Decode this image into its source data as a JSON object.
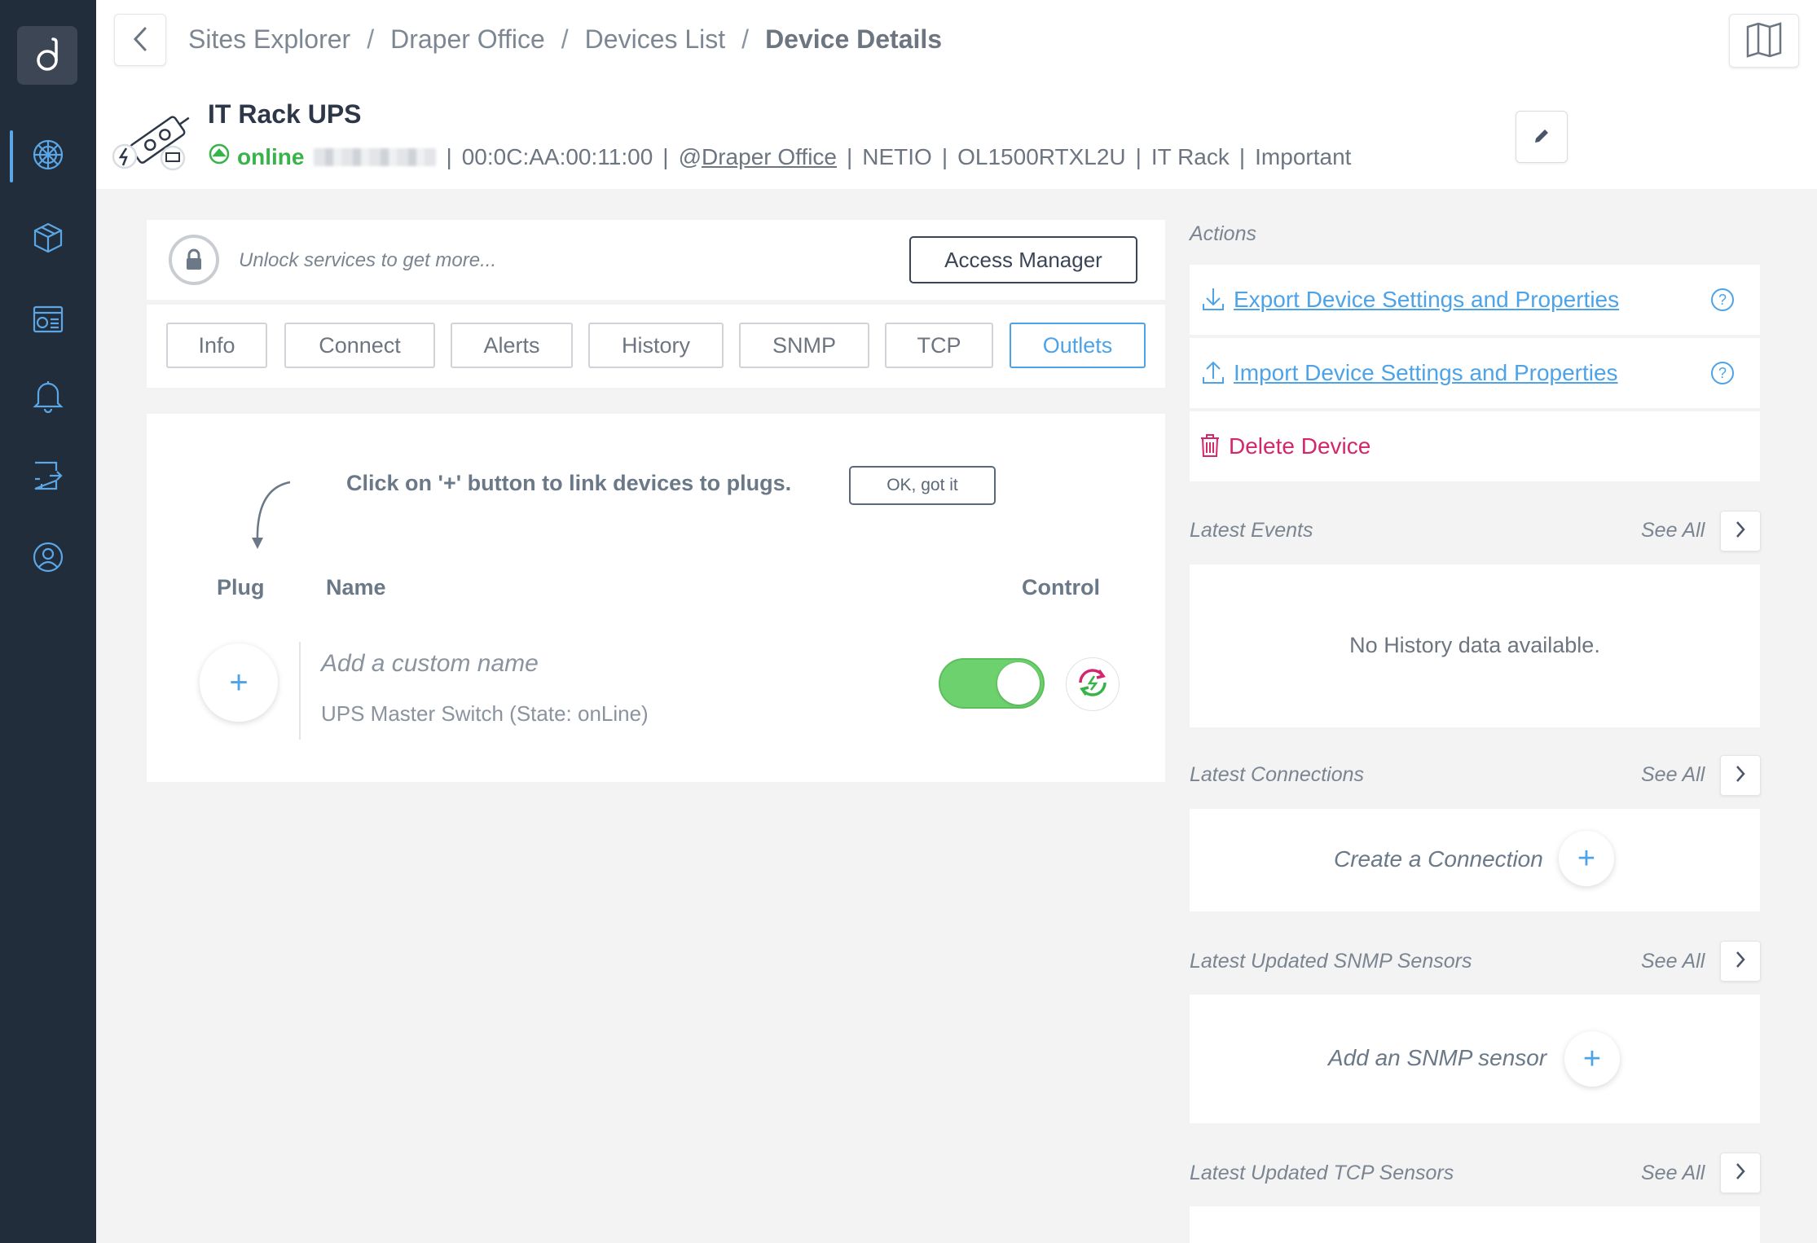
{
  "breadcrumb": {
    "items": [
      "Sites Explorer",
      "Draper Office",
      "Devices List"
    ],
    "current": "Device Details",
    "separator": "/"
  },
  "device": {
    "name": "IT Rack UPS",
    "status": "online",
    "mac": "00:0C:AA:00:11:00",
    "site_prefix": "@",
    "site": "Draper Office",
    "vendor": "NETIO",
    "model": "OL1500RTXL2U",
    "location": "IT Rack",
    "tag": "Important"
  },
  "unlock": {
    "text": "Unlock services to get more...",
    "button": "Access Manager"
  },
  "tabs": [
    {
      "label": "Info",
      "active": false
    },
    {
      "label": "Connect",
      "active": false
    },
    {
      "label": "Alerts",
      "active": false
    },
    {
      "label": "History",
      "active": false
    },
    {
      "label": "SNMP",
      "active": false
    },
    {
      "label": "TCP",
      "active": false
    },
    {
      "label": "Outlets",
      "active": true
    }
  ],
  "outlets": {
    "hint": "Click on '+' button to link devices to plugs.",
    "ok_button": "OK, got it",
    "columns": {
      "plug": "Plug",
      "name": "Name",
      "control": "Control"
    },
    "row": {
      "plus": "+",
      "placeholder_name": "Add a custom name",
      "description": "UPS Master Switch (State: onLine)",
      "toggle_on": true
    }
  },
  "actions": {
    "title": "Actions",
    "export": "Export Device Settings and Properties",
    "import": "Import Device Settings and Properties",
    "delete": "Delete Device",
    "help": "?"
  },
  "latest_events": {
    "title": "Latest Events",
    "see_all": "See All",
    "empty": "No History data available."
  },
  "latest_connections": {
    "title": "Latest Connections",
    "see_all": "See All",
    "create": "Create a Connection",
    "plus": "+"
  },
  "latest_snmp": {
    "title": "Latest Updated SNMP Sensors",
    "see_all": "See All",
    "create": "Add an SNMP sensor",
    "plus": "+"
  },
  "latest_tcp": {
    "title": "Latest Updated TCP Sensors",
    "see_all": "See All"
  },
  "colors": {
    "sidebar": "#222d3b",
    "accent": "#4da3e8",
    "online": "#38b34a",
    "delete": "#d3266b",
    "toggle": "#6dd16d"
  },
  "icons": {
    "nav": [
      "globe-icon",
      "cube-icon",
      "dashboard-icon",
      "bell-icon",
      "integrations-icon",
      "user-icon"
    ]
  }
}
